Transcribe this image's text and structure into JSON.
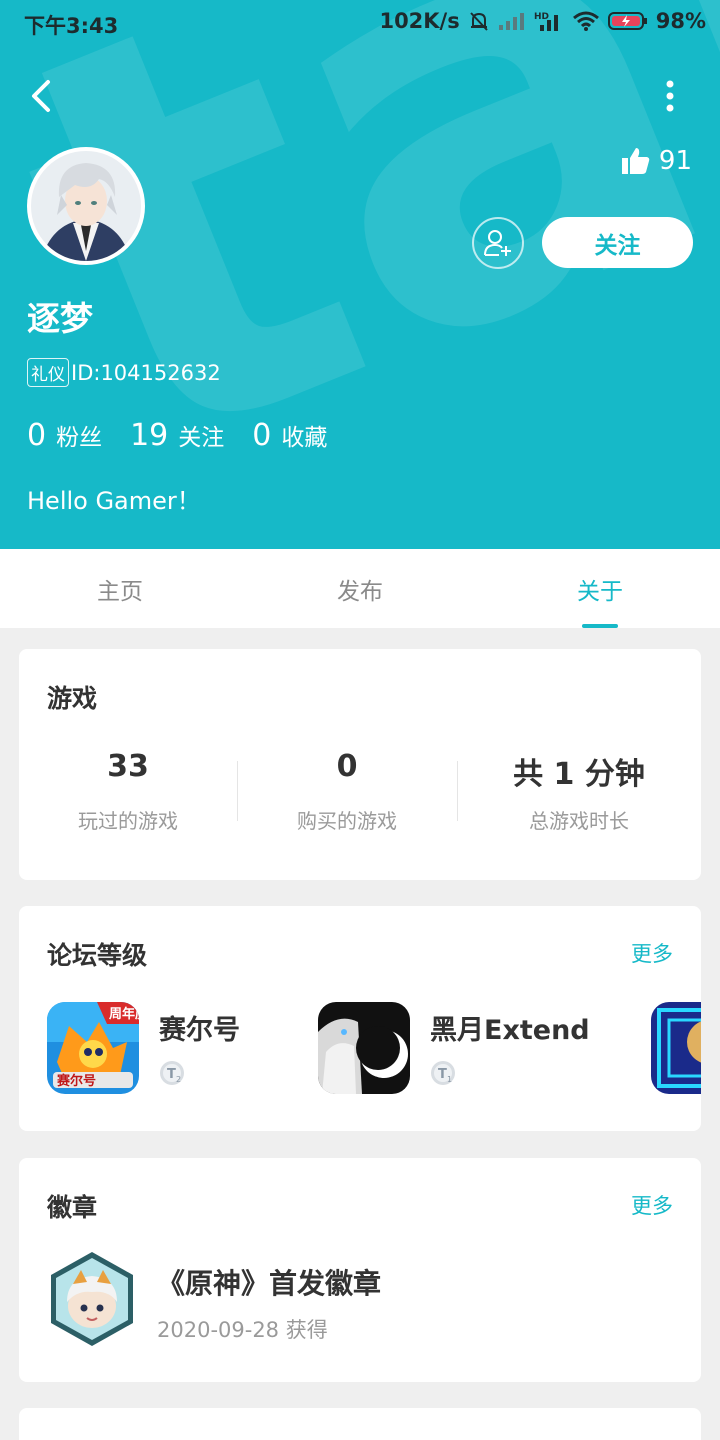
{
  "status_bar": {
    "time": "下午3:43",
    "net_speed": "102K/s",
    "battery": "98%"
  },
  "profile": {
    "username": "逐梦",
    "tag": "礼仪",
    "user_id": "ID:104152632",
    "likes": "91",
    "follow_label": "关注",
    "bio": "Hello Gamer！",
    "stats": [
      {
        "value": "0",
        "label": "粉丝"
      },
      {
        "value": "19",
        "label": "关注"
      },
      {
        "value": "0",
        "label": "收藏"
      }
    ]
  },
  "tabs": [
    {
      "label": "主页",
      "active": false
    },
    {
      "label": "发布",
      "active": false
    },
    {
      "label": "关于",
      "active": true
    }
  ],
  "games_card": {
    "title": "游戏",
    "items": [
      {
        "value": "33",
        "label": "玩过的游戏"
      },
      {
        "value": "0",
        "label": "购买的游戏"
      },
      {
        "value": "共 1 分钟",
        "label": "总游戏时长"
      }
    ]
  },
  "forum_card": {
    "title": "论坛等级",
    "more": "更多",
    "items": [
      {
        "name": "赛尔号",
        "level": "2",
        "banner": "周年庆"
      },
      {
        "name": "黑月Extend",
        "level": "1"
      }
    ]
  },
  "badge_card": {
    "title": "徽章",
    "more": "更多",
    "badge_name": "《原神》首发徽章",
    "badge_date": "2020-09-28 获得"
  },
  "colors": {
    "accent": "#16b9c8",
    "background": "#efefef"
  }
}
